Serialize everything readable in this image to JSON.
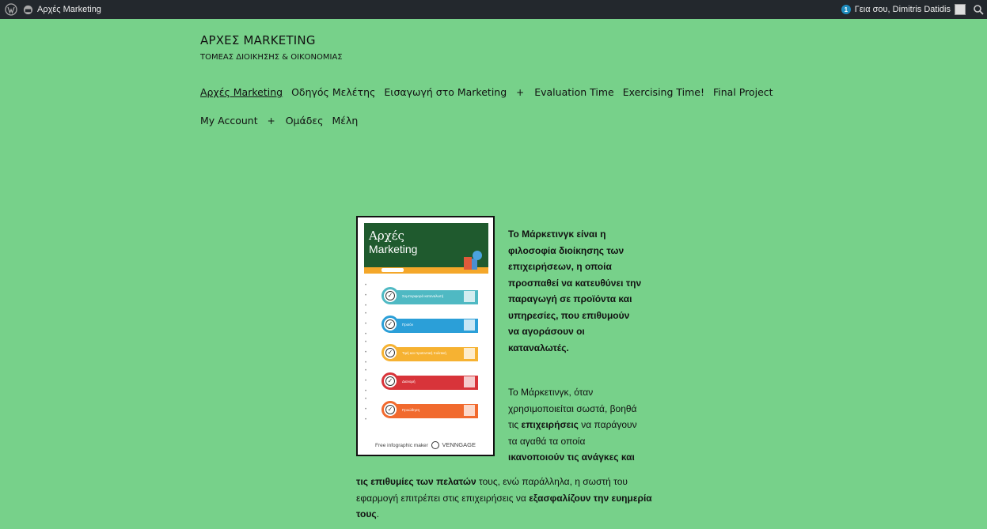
{
  "admin_bar": {
    "site_name": "Αρχές Marketing",
    "notification_count": "1",
    "greeting": "Γεια σου, Dimitris Datidis"
  },
  "site": {
    "title": "ΑΡΧΕΣ MARKETING",
    "description": "ΤΟΜΕΑΣ ΔΙΟΙΚΗΣΗΣ & ΟΙΚΟΝΟΜΙΑΣ"
  },
  "nav": {
    "row1": [
      "Αρχές Marketing",
      "Οδηγός Μελέτης",
      "Εισαγωγή στο Marketing",
      "Evaluation Time",
      "Exercising Time!",
      "Final Project"
    ],
    "row2": [
      "My Account",
      "Ομάδες",
      "Μέλη"
    ],
    "plus": "+"
  },
  "infographic": {
    "title_line1": "Αρχές",
    "title_line2": "Marketing",
    "items": [
      {
        "label": "Συμπεριφορά καταναλωτή",
        "color": "#4fb9c3"
      },
      {
        "label": "Προϊόν",
        "color": "#2b9fd8"
      },
      {
        "label": "Τιμή και προϊοντική πολιτική",
        "color": "#f6b232"
      },
      {
        "label": "Διανομή",
        "color": "#d8343a"
      },
      {
        "label": "Προώθηση",
        "color": "#f16a2e"
      }
    ],
    "footer_small": "Free infographic maker",
    "footer_brand": "VENNGAGE"
  },
  "article": {
    "p1": "Το Μάρκετινγκ είναι η φιλοσοφία διοίκησης των επιχειρήσεων, η οποία προσπαθεί να κατευθύνει την παραγωγή σε προϊόντα και υπηρεσίες, που επιθυμούν να αγοράσουν οι καταναλωτές.",
    "p2_a": "Το Μάρκετινγκ, όταν χρησιμοποιείται σωστά, βοηθά τις ",
    "p2_b": "επιχειρήσεις",
    "p2_c": " να παράγουν τα αγαθά τα οποία ",
    "p2_d": "ικανοποιούν τις ανάγκες και",
    "p3_a": "τις επιθυμίες των πελατών",
    "p3_b": " τους, ενώ παράλληλα, η σωστή του εφαρμογή επιτρέπει στις επιχειρήσεις να ",
    "p3_c": "εξασφαλίζουν την ευημερία τους",
    "p3_d": "."
  },
  "colors": {
    "background": "#77d18a",
    "admin_bar": "#23282d"
  }
}
